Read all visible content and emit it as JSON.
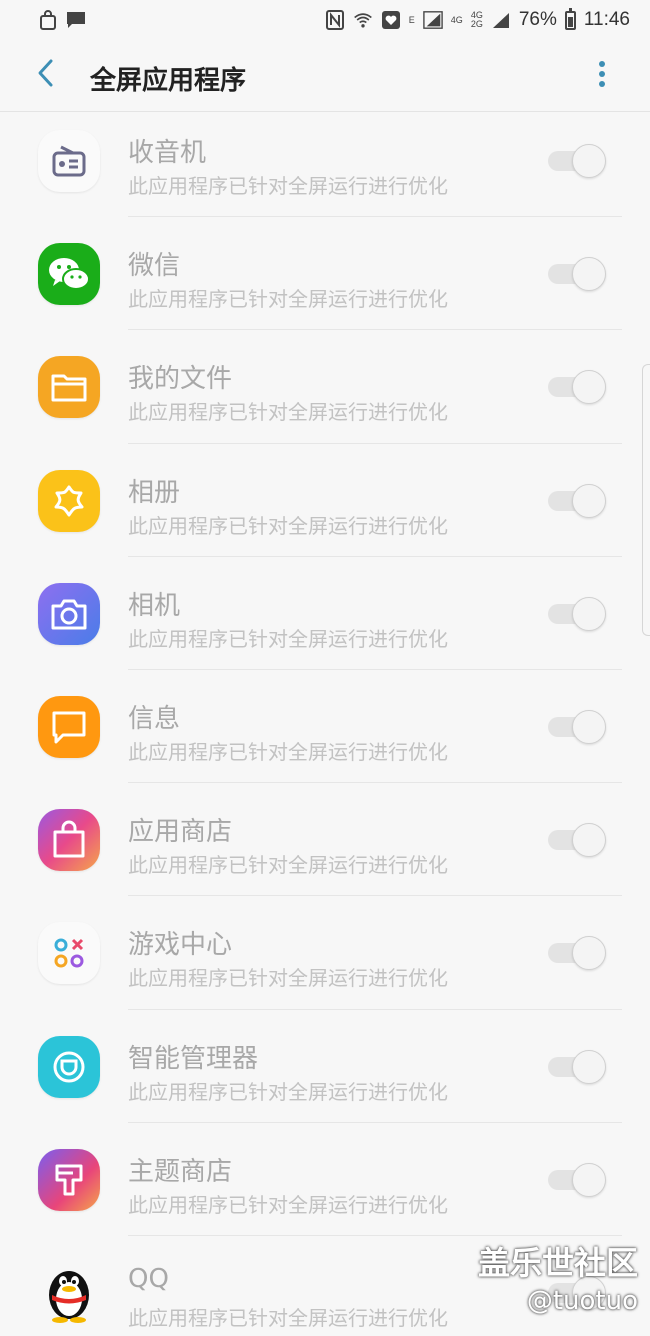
{
  "status_bar": {
    "battery_text": "76%",
    "time": "11:46",
    "network_labels": [
      "E",
      "4G",
      "4G",
      "2G"
    ],
    "battery_level": 0.76,
    "icons": [
      "shopping-bag-icon",
      "message-icon",
      "nfc-icon",
      "wifi-icon",
      "heart-box-icon",
      "signal-icon",
      "signal-icon",
      "battery-icon"
    ]
  },
  "app_bar": {
    "title": "全屏应用程序",
    "back_icon": "chevron-left-icon",
    "more_icon": "more-vertical-icon",
    "accent": "#3d8fb5"
  },
  "apps": [
    {
      "name": "收音机",
      "desc": "此应用程序已针对全屏运行进行优化",
      "icon": "radio-icon",
      "enabled": true
    },
    {
      "name": "微信",
      "desc": "此应用程序已针对全屏运行进行优化",
      "icon": "wechat-icon",
      "enabled": true
    },
    {
      "name": "我的文件",
      "desc": "此应用程序已针对全屏运行进行优化",
      "icon": "folder-icon",
      "enabled": true
    },
    {
      "name": "相册",
      "desc": "此应用程序已针对全屏运行进行优化",
      "icon": "gallery-icon",
      "enabled": true
    },
    {
      "name": "相机",
      "desc": "此应用程序已针对全屏运行进行优化",
      "icon": "camera-icon",
      "enabled": true
    },
    {
      "name": "信息",
      "desc": "此应用程序已针对全屏运行进行优化",
      "icon": "messages-icon",
      "enabled": true
    },
    {
      "name": "应用商店",
      "desc": "此应用程序已针对全屏运行进行优化",
      "icon": "store-icon",
      "enabled": true
    },
    {
      "name": "游戏中心",
      "desc": "此应用程序已针对全屏运行进行优化",
      "icon": "game-center-icon",
      "enabled": true
    },
    {
      "name": "智能管理器",
      "desc": "此应用程序已针对全屏运行进行优化",
      "icon": "smart-manager-icon",
      "enabled": true
    },
    {
      "name": "主题商店",
      "desc": "此应用程序已针对全屏运行进行优化",
      "icon": "theme-store-icon",
      "enabled": true
    },
    {
      "name": "QQ",
      "desc": "此应用程序已针对全屏运行进行优化",
      "icon": "qq-penguin-icon",
      "enabled": true
    }
  ],
  "watermark": {
    "line1": "盖乐世社区",
    "line2": "@tuotuo"
  }
}
